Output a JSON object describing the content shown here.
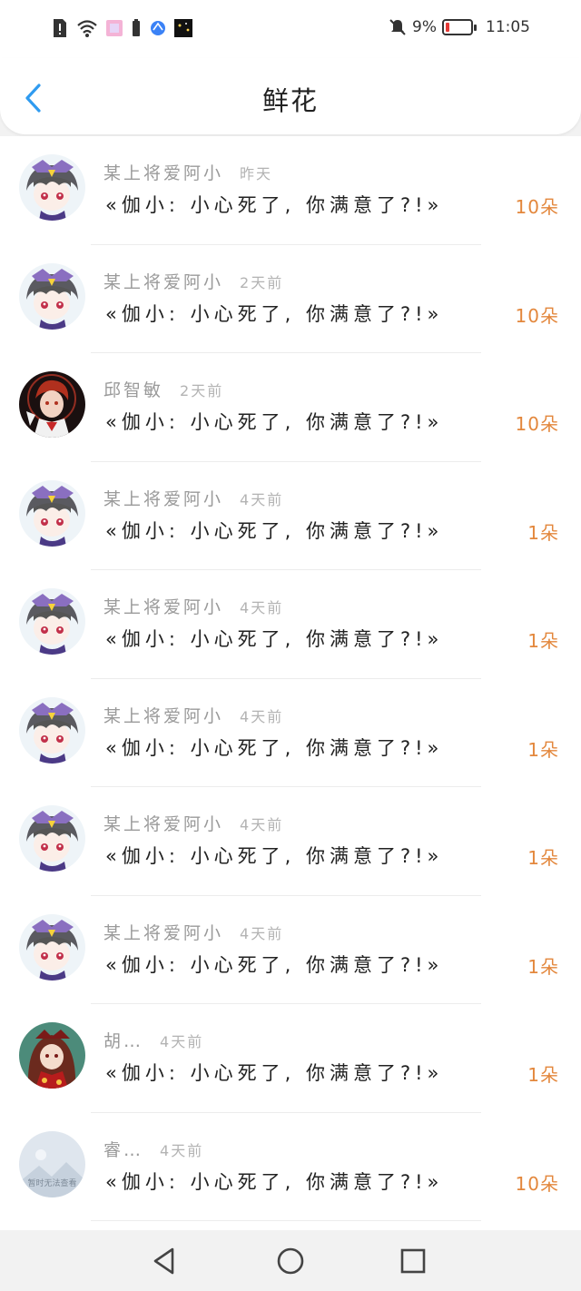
{
  "status": {
    "battery_percent": "9%",
    "time": "11:05"
  },
  "header": {
    "title": "鲜花"
  },
  "rows": [
    {
      "name": "某上将爱阿小",
      "time": "昨天",
      "message": "«伽小: 小心死了, 你满意了?!»",
      "count": "10朵",
      "avatar": "purple-hat-girl"
    },
    {
      "name": "某上将爱阿小",
      "time": "2天前",
      "message": "«伽小: 小心死了, 你满意了?!»",
      "count": "10朵",
      "avatar": "purple-hat-girl"
    },
    {
      "name": "邱智敏",
      "time": "2天前",
      "message": "«伽小: 小心死了, 你满意了?!»",
      "count": "10朵",
      "avatar": "red-hair-boy"
    },
    {
      "name": "某上将爱阿小",
      "time": "4天前",
      "message": "«伽小: 小心死了, 你满意了?!»",
      "count": "1朵",
      "avatar": "purple-hat-girl"
    },
    {
      "name": "某上将爱阿小",
      "time": "4天前",
      "message": "«伽小: 小心死了, 你满意了?!»",
      "count": "1朵",
      "avatar": "purple-hat-girl"
    },
    {
      "name": "某上将爱阿小",
      "time": "4天前",
      "message": "«伽小: 小心死了, 你满意了?!»",
      "count": "1朵",
      "avatar": "purple-hat-girl"
    },
    {
      "name": "某上将爱阿小",
      "time": "4天前",
      "message": "«伽小: 小心死了, 你满意了?!»",
      "count": "1朵",
      "avatar": "purple-hat-girl"
    },
    {
      "name": "某上将爱阿小",
      "time": "4天前",
      "message": "«伽小: 小心死了, 你满意了?!»",
      "count": "1朵",
      "avatar": "purple-hat-girl"
    },
    {
      "name": "胡…",
      "time": "4天前",
      "message": "«伽小: 小心死了, 你满意了?!»",
      "count": "1朵",
      "avatar": "brown-hair-girl"
    },
    {
      "name": "睿…",
      "time": "4天前",
      "message": "«伽小: 小心死了, 你满意了?!»",
      "count": "10朵",
      "avatar": "placeholder-image",
      "placeholder_text": "暂时无法查看"
    }
  ],
  "colors": {
    "accent": "#2f9bf0",
    "count": "#e3873c"
  }
}
